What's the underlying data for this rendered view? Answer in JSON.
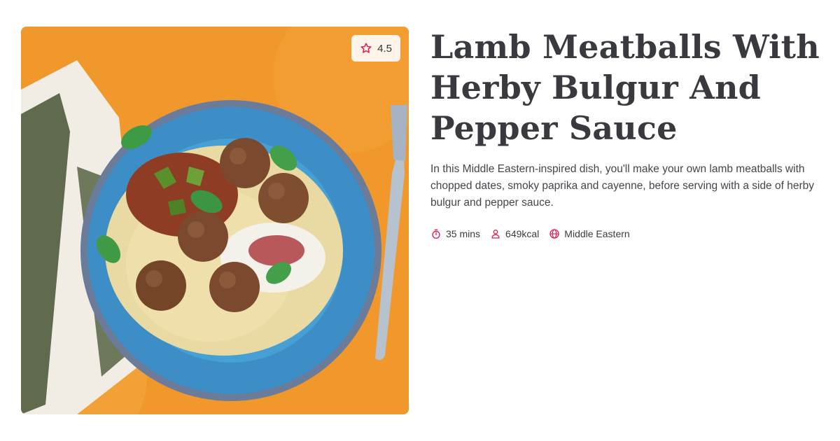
{
  "rating": {
    "value": "4.5",
    "icon": "star-outline-icon"
  },
  "recipe": {
    "title": "Lamb Meatballs With Herby Bulgur And Pepper Sauce",
    "description": "In this Middle Eastern-inspired dish, you'll make your own lamb meatballs with chopped dates, smoky paprika and cayenne, before serving with a side of herby bulgur and pepper sauce."
  },
  "meta": {
    "time": {
      "label": "35 mins",
      "icon": "timer-icon"
    },
    "calories": {
      "label": "649kcal",
      "icon": "person-icon"
    },
    "cuisine": {
      "label": "Middle Eastern",
      "icon": "globe-icon"
    }
  },
  "colors": {
    "accent": "#e21e50",
    "background": "#ffffff",
    "title": "#383a40"
  }
}
